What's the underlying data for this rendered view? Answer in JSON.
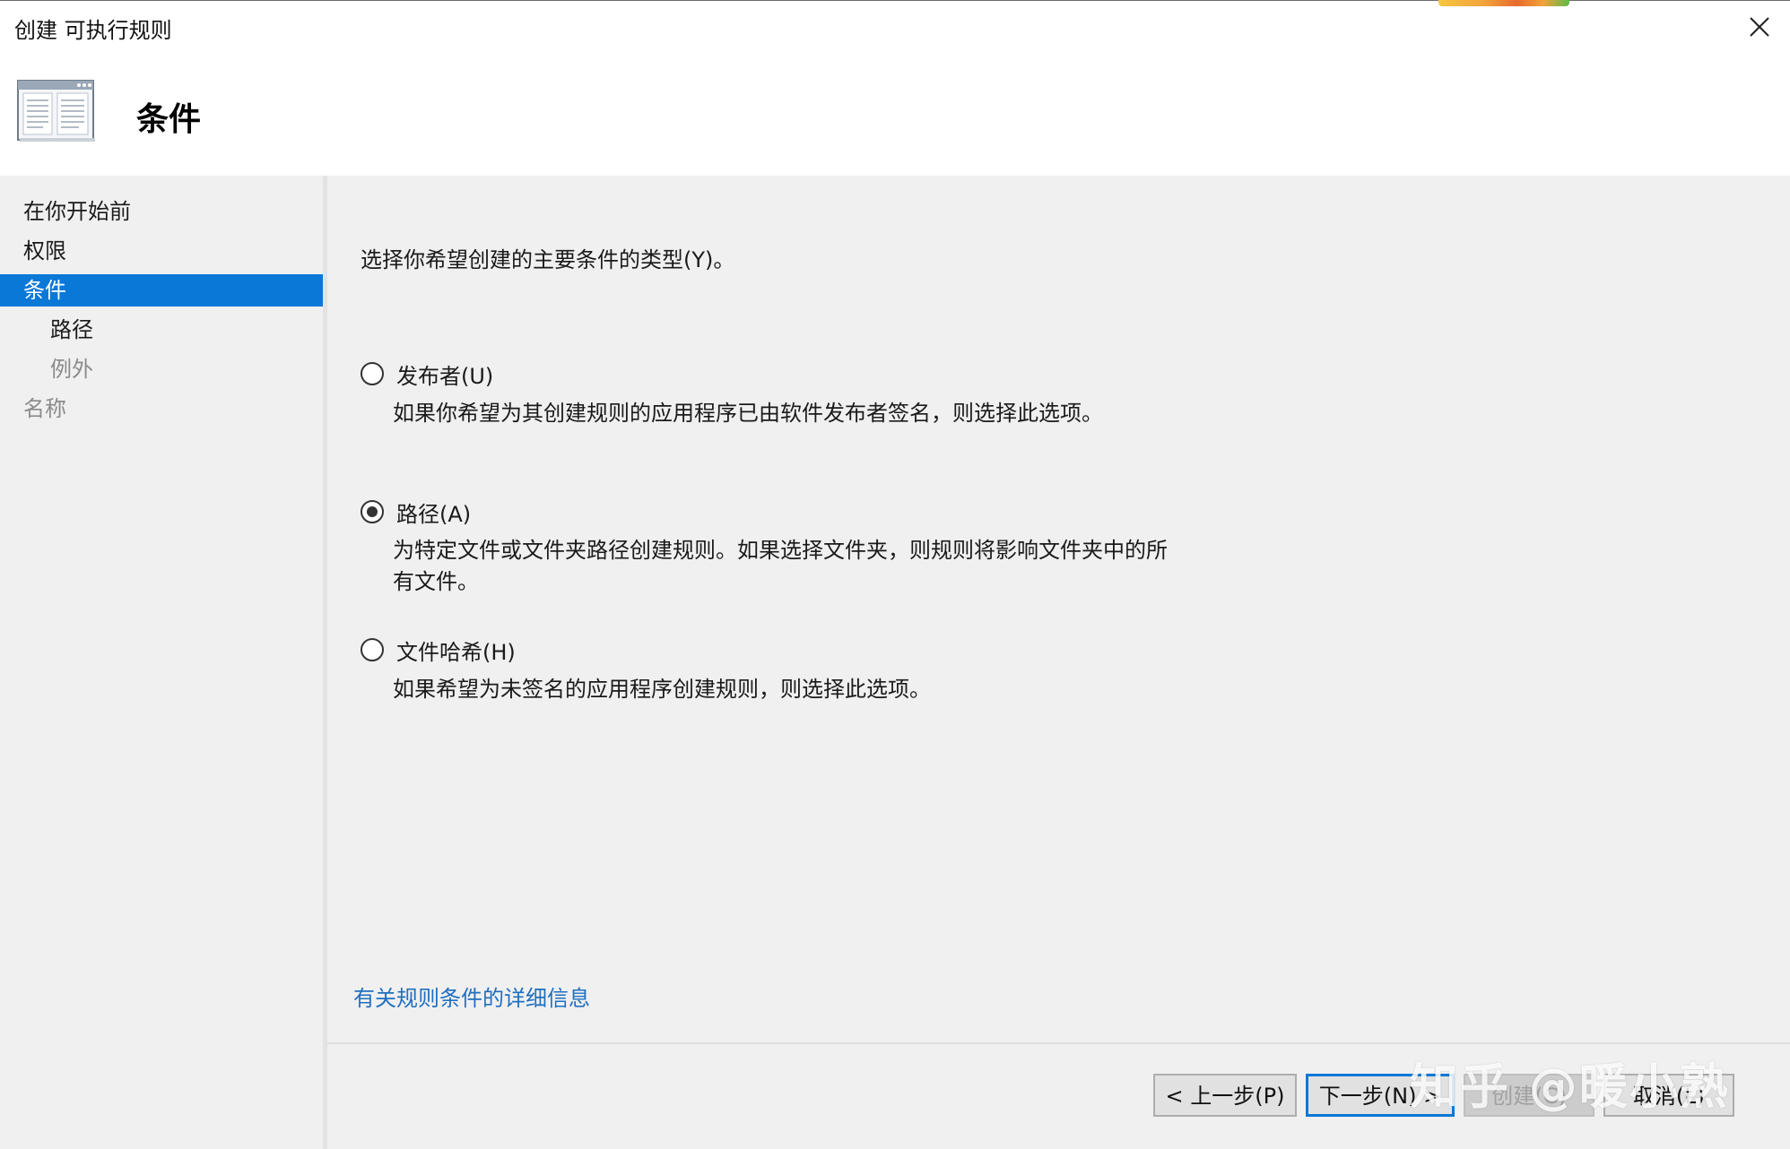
{
  "window": {
    "title": "创建 可执行规则",
    "close_icon": "close-icon"
  },
  "header": {
    "title": "条件",
    "icon": "rules-window-icon"
  },
  "sidebar": {
    "items": [
      {
        "label": "在你开始前",
        "state": "normal"
      },
      {
        "label": "权限",
        "state": "normal"
      },
      {
        "label": "条件",
        "state": "selected"
      },
      {
        "label": "路径",
        "state": "normal"
      },
      {
        "label": "例外",
        "state": "disabled"
      },
      {
        "label": "名称",
        "state": "disabled"
      }
    ]
  },
  "main": {
    "prompt": "选择你希望创建的主要条件的类型(Y)。",
    "options": [
      {
        "label": "发布者(U)",
        "selected": false,
        "description": "如果你希望为其创建规则的应用程序已由软件发布者签名，则选择此选项。"
      },
      {
        "label": "路径(A)",
        "selected": true,
        "description": "为特定文件或文件夹路径创建规则。如果选择文件夹，则规则将影响文件夹中的所有文件。"
      },
      {
        "label": "文件哈希(H)",
        "selected": false,
        "description": "如果希望为未签名的应用程序创建规则，则选择此选项。"
      }
    ],
    "help_link": "有关规则条件的详细信息"
  },
  "footer": {
    "back_button": "< 上一步(P)",
    "next_button": "下一步(N) >",
    "create_button": "创建(C)",
    "cancel_button": "取消(L)"
  },
  "watermark": "知乎 @暖小熟",
  "colors": {
    "accent": "#0a78d7",
    "link": "#1f6fc0",
    "panel": "#f0f0f0"
  }
}
